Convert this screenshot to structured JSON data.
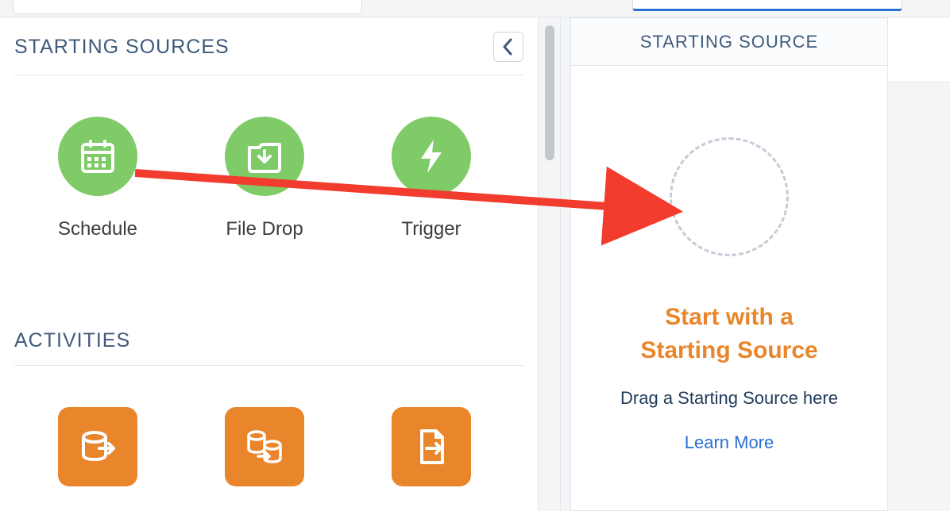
{
  "top": {},
  "palette": {
    "starting_sources_title": "STARTING SOURCES",
    "sources": [
      {
        "label": "Schedule"
      },
      {
        "label": "File Drop"
      },
      {
        "label": "Trigger"
      }
    ],
    "activities_title": "ACTIVITIES"
  },
  "canvas": {
    "header": "STARTING SOURCE",
    "heading_line1": "Start with a",
    "heading_line2": "Starting Source",
    "subtext": "Drag a Starting Source here",
    "learn_more": "Learn More"
  }
}
